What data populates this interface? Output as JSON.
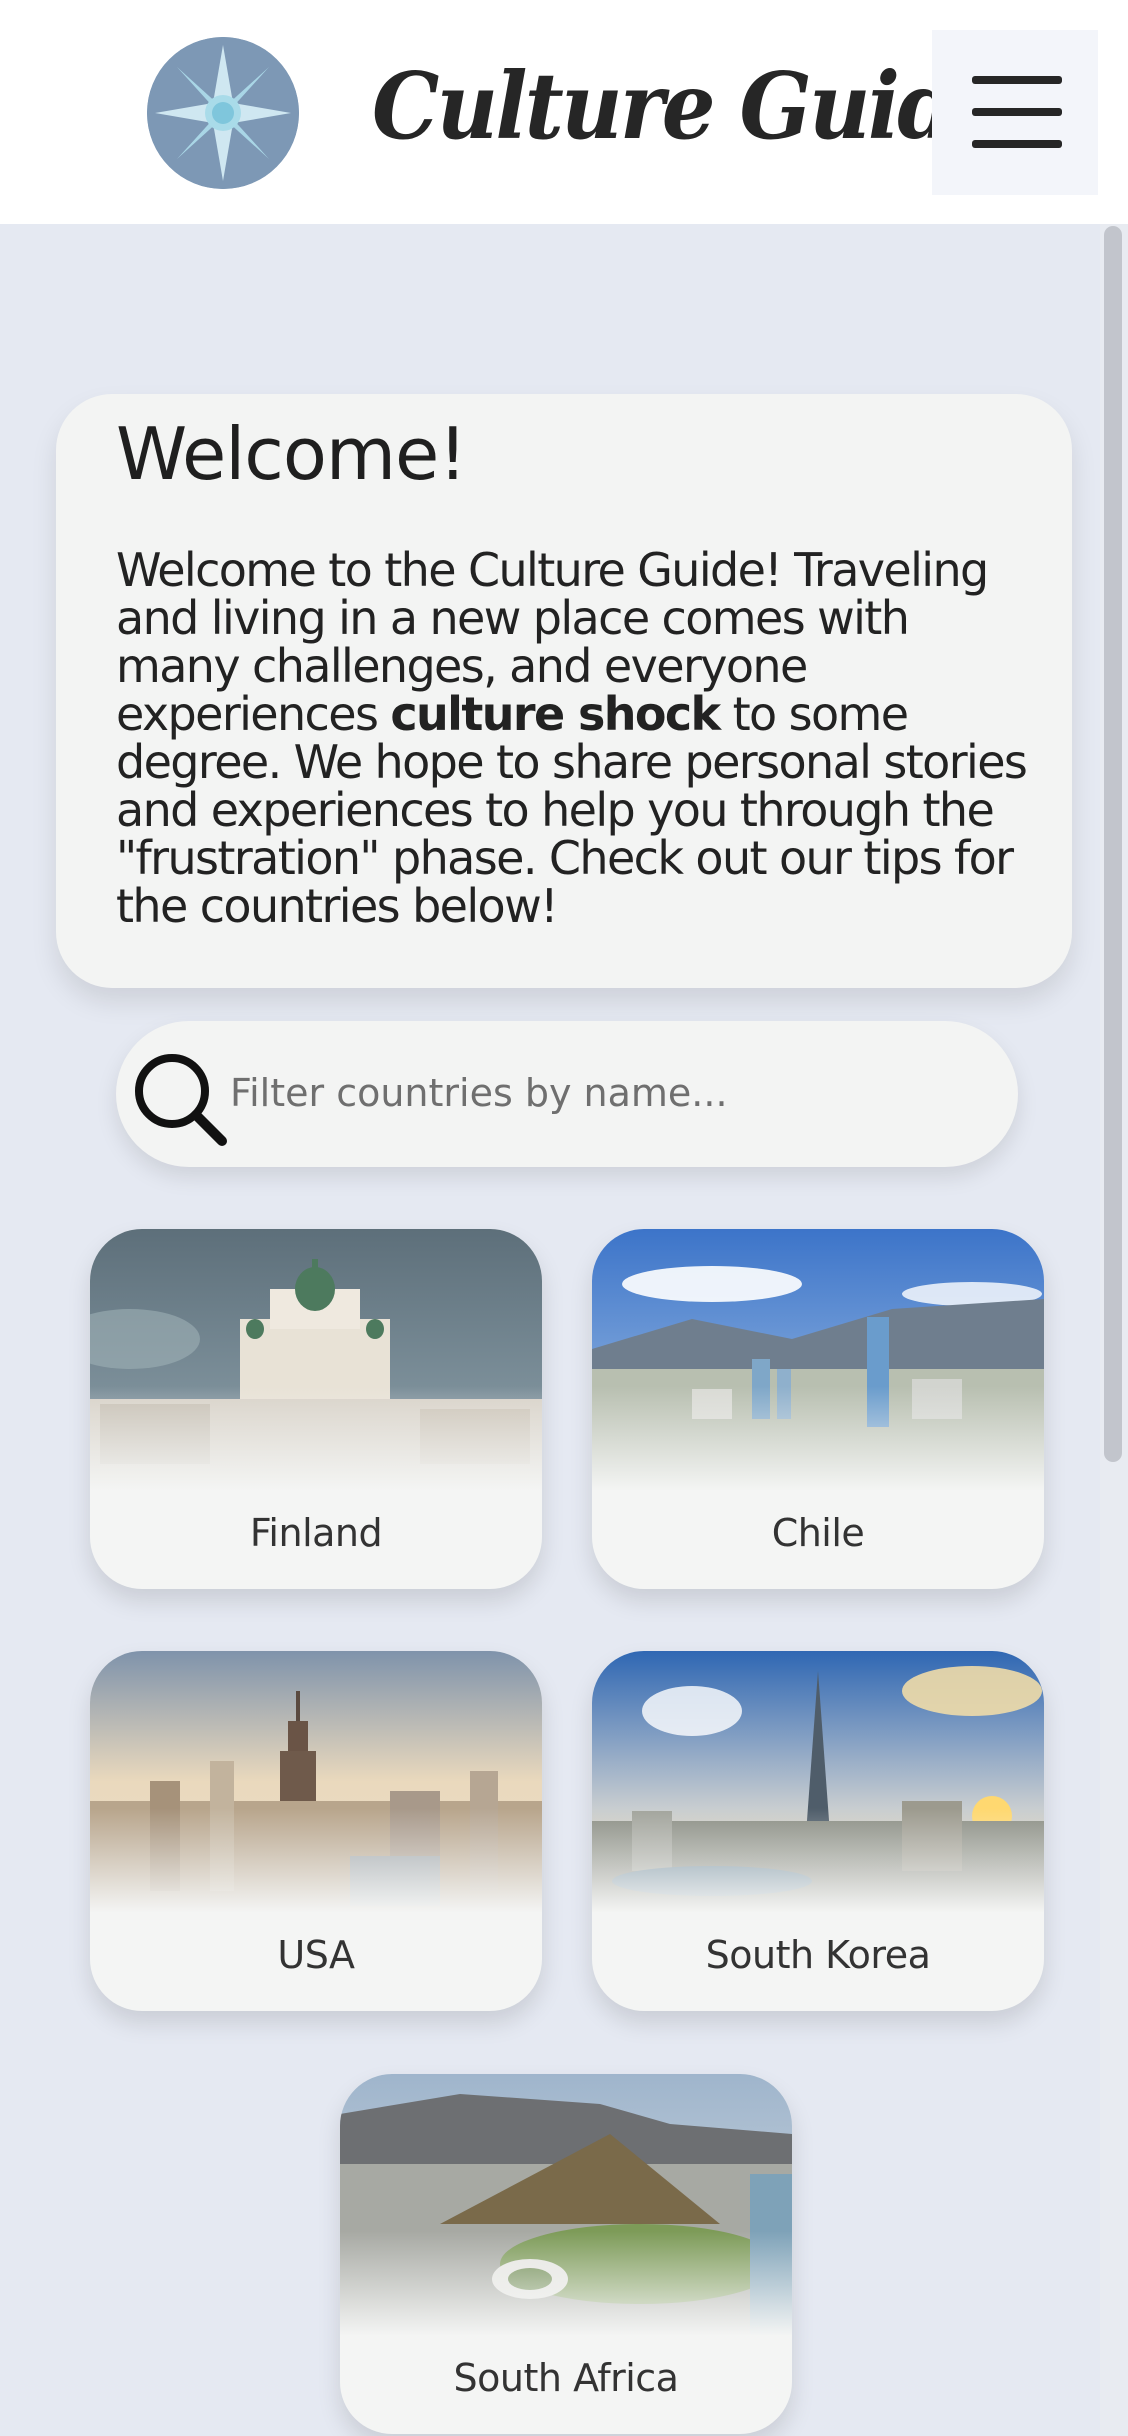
{
  "header": {
    "title": "Culture Guide",
    "logo_icon": "compass-rose-icon",
    "menu_icon": "hamburger-menu-icon"
  },
  "welcome": {
    "title": "Welcome!",
    "text_before": "Welcome to the Culture Guide! Traveling and living in a new place comes with many challenges, and everyone experiences ",
    "text_bold": "culture shock",
    "text_after": " to some degree. We hope to share personal stories and experiences to help you through the \"frustration\" phase. Check out our tips for the countries below!"
  },
  "search": {
    "placeholder": "Filter countries by name...",
    "value": "",
    "icon": "search-icon"
  },
  "countries": [
    {
      "name": "Finland"
    },
    {
      "name": "Chile"
    },
    {
      "name": "USA"
    },
    {
      "name": "South Korea"
    },
    {
      "name": "South Africa"
    }
  ],
  "colors": {
    "page_background": "#e5e9f2",
    "card_background": "#f3f4f3",
    "logo_background": "#7d98b5",
    "text": "#1f1f1f"
  }
}
